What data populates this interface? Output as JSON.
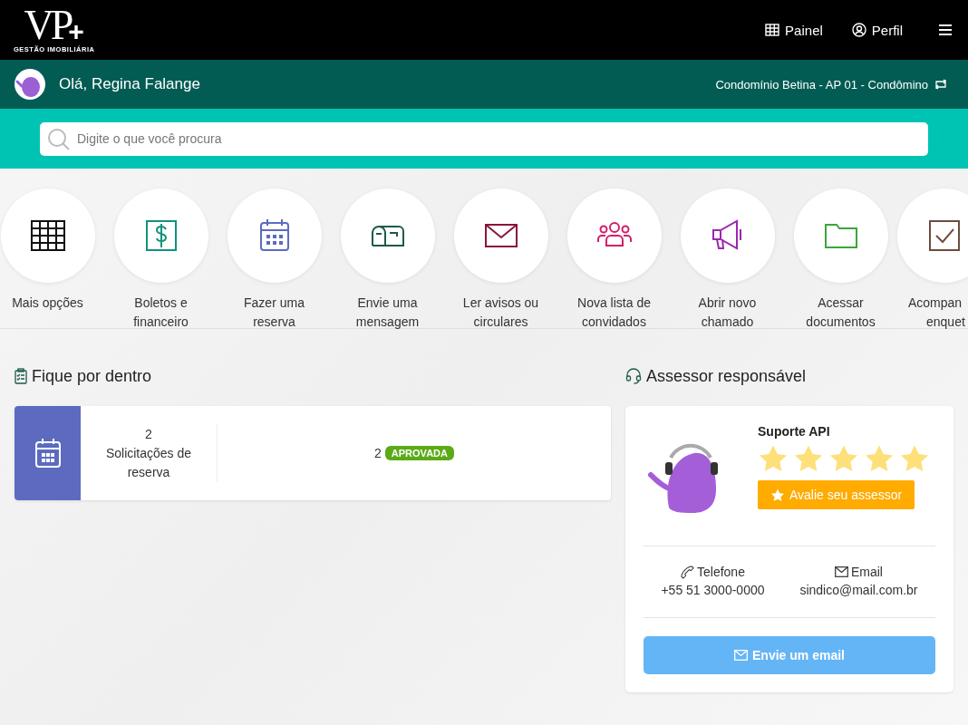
{
  "header": {
    "logo": {
      "mark": "VP",
      "plus": "+",
      "tagline": "GESTÃO IMOBILIÁRIA"
    },
    "nav": [
      {
        "kind": "grid",
        "label": "Painel"
      },
      {
        "kind": "user",
        "label": "Perfil"
      }
    ]
  },
  "user_bar": {
    "greeting": "Olá, Regina Falange",
    "unit": "Condomínio Betina - AP 01 - Condômino"
  },
  "search": {
    "placeholder": "Digite o que você procura"
  },
  "shortcuts": [
    {
      "kind": "grid",
      "color": "#111111",
      "label": [
        "Mais opções"
      ]
    },
    {
      "kind": "dollar",
      "color": "#12927e",
      "label": [
        "Boletos e",
        "financeiro"
      ]
    },
    {
      "kind": "calendar",
      "color": "#5c6bc0",
      "label": [
        "Fazer uma",
        "reserva"
      ]
    },
    {
      "kind": "mailbox",
      "color": "#1d5a4a",
      "label": [
        "Envie uma",
        "mensagem"
      ]
    },
    {
      "kind": "envelope",
      "color": "#8a1538",
      "label": [
        "Ler avisos ou",
        "circulares"
      ]
    },
    {
      "kind": "people",
      "color": "#d41e6d",
      "label": [
        "Nova lista de",
        "convidados"
      ]
    },
    {
      "kind": "megaphone",
      "color": "#9c27b0",
      "label": [
        "Abrir novo",
        "chamado"
      ]
    },
    {
      "kind": "folder",
      "color": "#3aa63a",
      "label": [
        "Acessar",
        "documentos"
      ]
    },
    {
      "kind": "check",
      "color": "#6d4c41",
      "label": [
        "Acompan",
        "enquet"
      ]
    }
  ],
  "news": {
    "title": "Fique por dentro",
    "cards": [
      {
        "count": "2",
        "label": "Solicitações de reserva",
        "status_count": "2",
        "badge": "APROVADA"
      }
    ]
  },
  "advisor": {
    "title": "Assessor responsável",
    "name": "Suporte API",
    "stars": 5,
    "rate_button": "Avalie seu assessor",
    "phone_label": "Telefone",
    "phone": "+55 51 3000-0000",
    "email_label": "Email",
    "email": "sindico@mail.com.br",
    "email_button": "Envie um email"
  }
}
